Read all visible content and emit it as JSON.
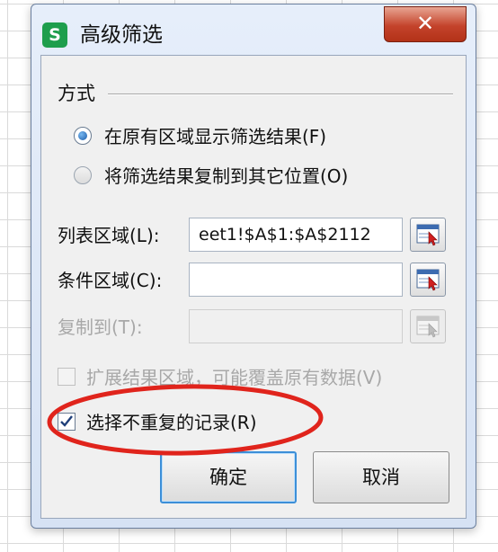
{
  "dialog": {
    "title": "高级筛选",
    "app_icon": "S",
    "close_label": "✕",
    "group_label": "方式",
    "mode_options": [
      {
        "label": "在原有区域显示筛选结果(F)",
        "checked": true
      },
      {
        "label": "将筛选结果复制到其它位置(O)",
        "checked": false
      }
    ],
    "list_range": {
      "label": "列表区域(L):",
      "value": "eet1!$A$1:$A$2112"
    },
    "criteria_range": {
      "label": "条件区域(C):",
      "value": ""
    },
    "copy_to": {
      "label": "复制到(T):",
      "value": "",
      "disabled": true
    },
    "extend_result": {
      "label": "扩展结果区域，可能覆盖原有数据(V)",
      "checked": false,
      "disabled": true
    },
    "unique_records": {
      "label": "选择不重复的记录(R)",
      "checked": true
    },
    "ok_label": "确定",
    "cancel_label": "取消"
  },
  "colors": {
    "highlight_ellipse": "#e0241c",
    "primary_border": "#3c8fd8",
    "app_icon_bg": "#1e9e4c",
    "close_bg": "#c4432b"
  },
  "icons": {
    "app": "wps-spreadsheet-icon",
    "close": "close-icon",
    "range_picker": "range-select-icon",
    "check": "checkmark-icon"
  }
}
